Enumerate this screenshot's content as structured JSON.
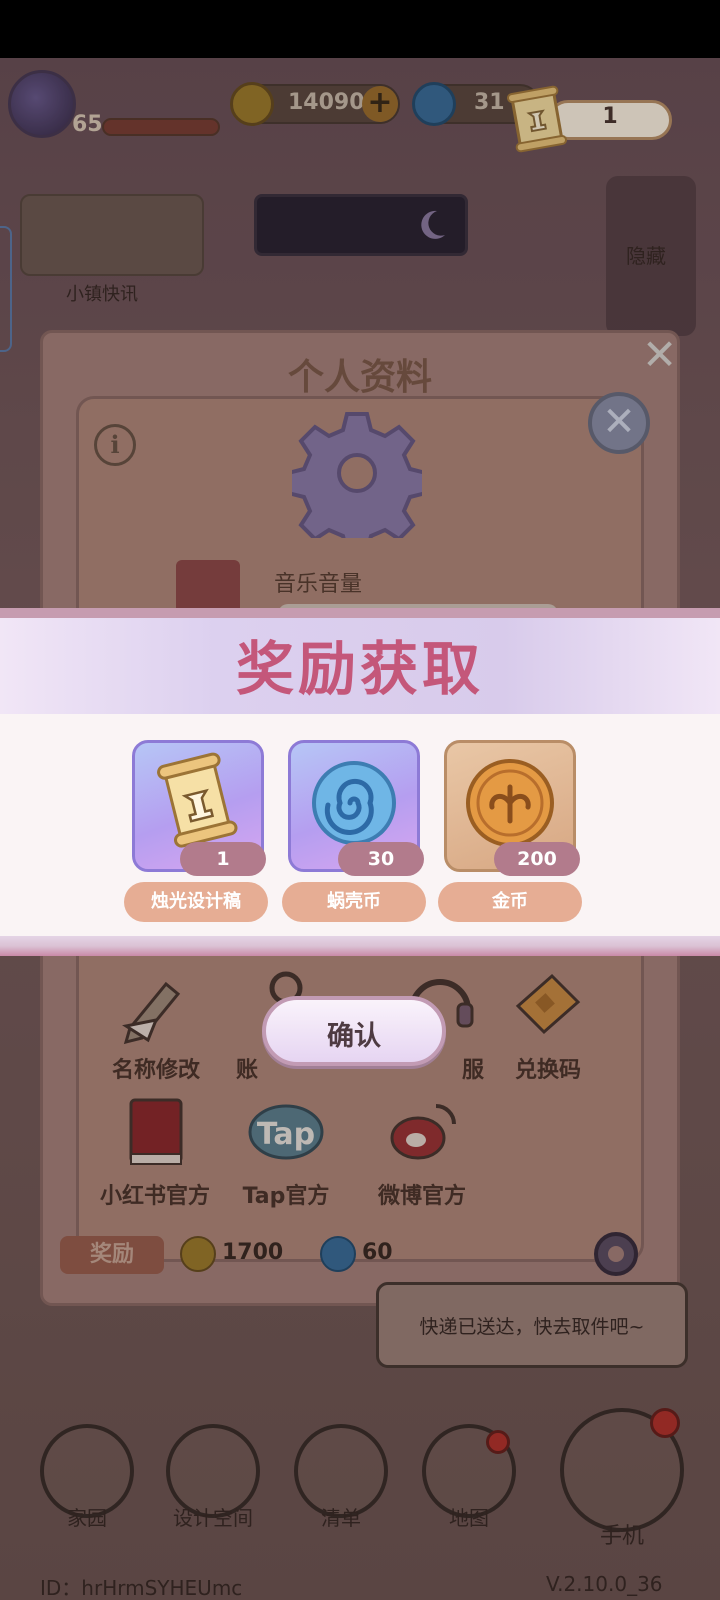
{
  "player": {
    "level": "65"
  },
  "resources": {
    "gold": "14090",
    "snail": "31",
    "design_scrolls": "1"
  },
  "town": {
    "news_label": "小镇快讯",
    "hide_label": "隐藏"
  },
  "profile": {
    "title": "个人资料",
    "music_volume_label": "音乐音量",
    "grid": [
      {
        "label": "名称修改",
        "icon": "pencil-icon"
      },
      {
        "label": "账",
        "icon": "key-icon"
      },
      {
        "label": "服",
        "icon": "headset-icon"
      },
      {
        "label": "兑换码",
        "icon": "ticket-icon"
      },
      {
        "label": "小红书官方",
        "icon": "red-book-icon"
      },
      {
        "label": "Tap官方",
        "icon": "tap-logo-icon"
      },
      {
        "label": "微博官方",
        "icon": "weibo-icon"
      }
    ],
    "reward_tag": "奖励",
    "reward_gold": "1700",
    "reward_snail": "60"
  },
  "speech_bubble": "快递已送达，快去取件吧~",
  "bottom_nav": [
    {
      "label": "家园",
      "icon": "home-icon"
    },
    {
      "label": "设计空间",
      "icon": "design-icon"
    },
    {
      "label": "清单",
      "icon": "list-icon"
    },
    {
      "label": "地图",
      "icon": "map-pin-icon"
    }
  ],
  "phone_label": "手机",
  "footer": {
    "id": "ID：hrHrmSYHEUmc",
    "version": "V.2.10.0_36"
  },
  "reward_popup": {
    "title": "奖励获取",
    "items": [
      {
        "name": "烛光设计稿",
        "qty": "1",
        "icon": "design-scroll-icon"
      },
      {
        "name": "蜗壳币",
        "qty": "30",
        "icon": "snail-coin-icon"
      },
      {
        "name": "金币",
        "qty": "200",
        "icon": "gold-coin-icon"
      }
    ],
    "confirm_label": "确认"
  },
  "colors": {
    "accent_pink": "#c4577a",
    "card_purple": "#b59ef0",
    "tag_peach": "#e6ad94"
  }
}
